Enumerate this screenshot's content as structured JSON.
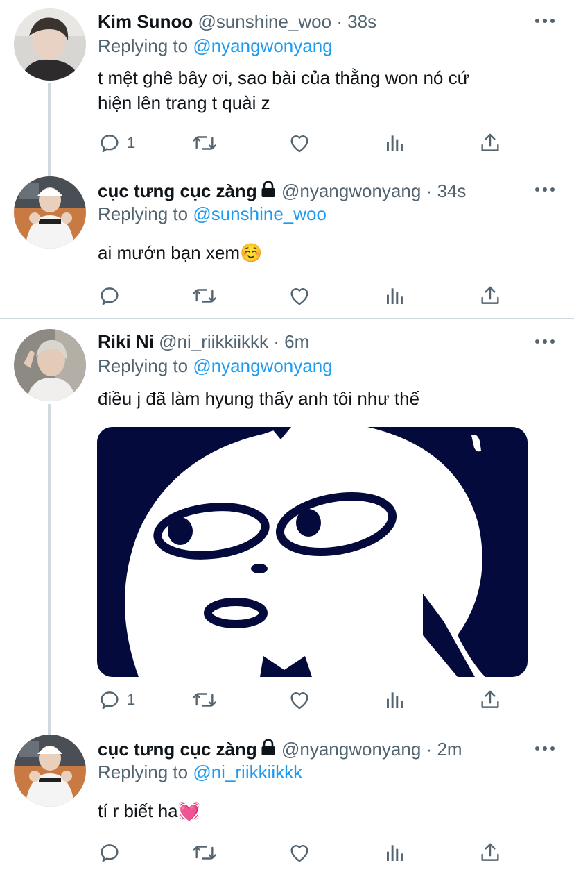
{
  "tweets": [
    {
      "name": "Kim Sunoo",
      "handle": "@sunshine_woo",
      "sep": "·",
      "time": "38s",
      "replying_prefix": "Replying to",
      "replying_to": "@nyangwonyang",
      "text_line1": "t mệt ghê bây ơi, sao bài của thằng won nó cứ",
      "text_line2": "hiện lên trang t quài z",
      "reply_count": "1"
    },
    {
      "name": "cục tưng cục zàng",
      "handle": "@nyangwonyang",
      "sep": "·",
      "time": "34s",
      "replying_prefix": "Replying to",
      "replying_to": "@sunshine_woo",
      "text": "ai mướn bạn xem☺️",
      "reply_count": ""
    },
    {
      "name": "Riki Ni",
      "handle": "@ni_riikkiikkk",
      "sep": "·",
      "time": "6m",
      "replying_prefix": "Replying to",
      "replying_to": "@nyangwonyang",
      "text": "điều j đã làm hyung thấy anh tôi như thế",
      "reply_count": "1"
    },
    {
      "name": "cục tưng cục zàng",
      "handle": "@nyangwonyang",
      "sep": "·",
      "time": "2m",
      "replying_prefix": "Replying to",
      "replying_to": "@ni_riikkiikkk",
      "text": "tí r biết ha💓",
      "reply_count": ""
    }
  ],
  "icons": {
    "reply": "reply-icon",
    "retweet": "retweet-icon",
    "like": "like-icon",
    "analytics": "analytics-icon",
    "share": "share-icon",
    "more": "more-icon",
    "lock": "lock-icon"
  },
  "colors": {
    "link": "#1d9bf0",
    "secondary": "#536471",
    "meme_navy": "#050a3d"
  }
}
